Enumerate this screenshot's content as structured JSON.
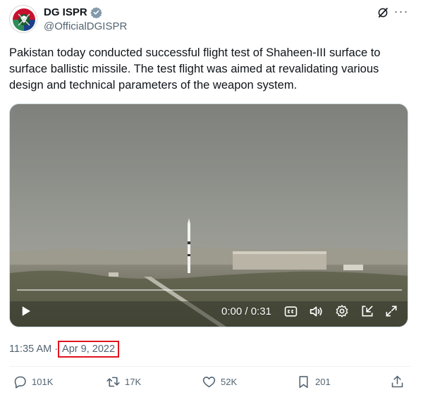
{
  "author": {
    "display_name": "DG ISPR",
    "handle": "@OfficialDGISPR",
    "verified": true,
    "avatar_icon": "ispr-emblem-icon"
  },
  "header_icons": [
    "grok-icon",
    "more-options-icon"
  ],
  "tweet": {
    "text": "Pakistan today conducted successful flight test of Shaheen-III surface to surface ballistic missile. The test flight was aimed at revalidating various design and technical parameters of the weapon system."
  },
  "video": {
    "time_display": "0:00 / 0:31",
    "progress": 0.0,
    "controls": [
      "play-icon",
      "cc-icon",
      "volume-icon",
      "settings-icon",
      "pip-icon",
      "fullscreen-icon"
    ]
  },
  "meta": {
    "time": "11:35 AM",
    "separator": "·",
    "date": "Apr 9, 2022",
    "highlight_color": "#e0141d"
  },
  "actions": {
    "replies": "101K",
    "reposts": "17K",
    "likes": "52K",
    "bookmarks": "201"
  },
  "colors": {
    "text_primary": "#0f1419",
    "text_secondary": "#536471",
    "verified_badge": "#829aab"
  }
}
